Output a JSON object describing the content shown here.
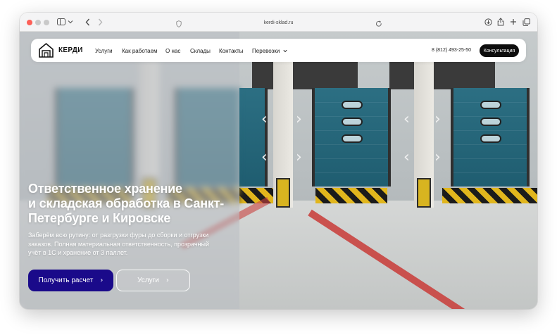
{
  "browser": {
    "url": "kerdi-sklad.ru",
    "icons": [
      "sidebar-icon",
      "chevron-down-icon",
      "back-icon",
      "forward-icon",
      "shield-icon",
      "reload-icon",
      "download-icon",
      "share-icon",
      "new-tab-icon",
      "tabs-overview-icon"
    ]
  },
  "site": {
    "brand": "КЕРДИ",
    "nav": [
      "Услуги",
      "Как работаем",
      "О нас",
      "Склады",
      "Контакты",
      "Перевозки"
    ],
    "phone": "8 (812) 493-25-50",
    "cta": "Консультация"
  },
  "hero": {
    "title_line1": "Ответственное хранение",
    "title_line2": "и складская обработка в Санкт-",
    "title_line3": "Петербурге и Кировске",
    "sub_line1": "Заберём всю рутину: от разгрузки фуры до сборки и отгрузки",
    "sub_line2": "заказов. Полная материальная ответственность, прозрачный",
    "sub_line3": "учёт в 1С и хранение от 3 паллет.",
    "btn_primary": "Получить расчет",
    "btn_secondary": "Услуги"
  },
  "colors": {
    "accent": "#1a0a8a",
    "cta_bg": "#0d0d0d",
    "traffic_red": "#fd5f57"
  }
}
